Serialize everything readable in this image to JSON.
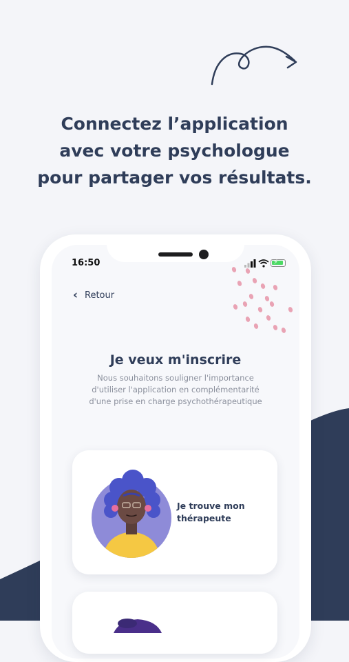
{
  "headline": {
    "line1": "Connectez l’application",
    "line2": "avec votre psychologue",
    "line3": "pour partager vos résultats."
  },
  "status_bar": {
    "time": "16:50"
  },
  "nav": {
    "back_label": "Retour"
  },
  "screen": {
    "title": "Je veux m'inscrire",
    "subtitle_lines": [
      "Nous souhaitons souligner l'importance",
      "d'utiliser l'application en complémentarité",
      "d'une prise en charge psychothérapeutique"
    ]
  },
  "options": [
    {
      "label_line1": "Je trouve mon",
      "label_line2": "thérapeute",
      "icon": "therapist-avatar-icon"
    },
    {
      "label_line1": "",
      "label_line2": "",
      "icon": "patient-avatar-icon"
    }
  ],
  "colors": {
    "navy": "#2f3d59",
    "background": "#f4f5f9",
    "accent_pink": "#e9a3b4",
    "card": "#ffffff"
  }
}
